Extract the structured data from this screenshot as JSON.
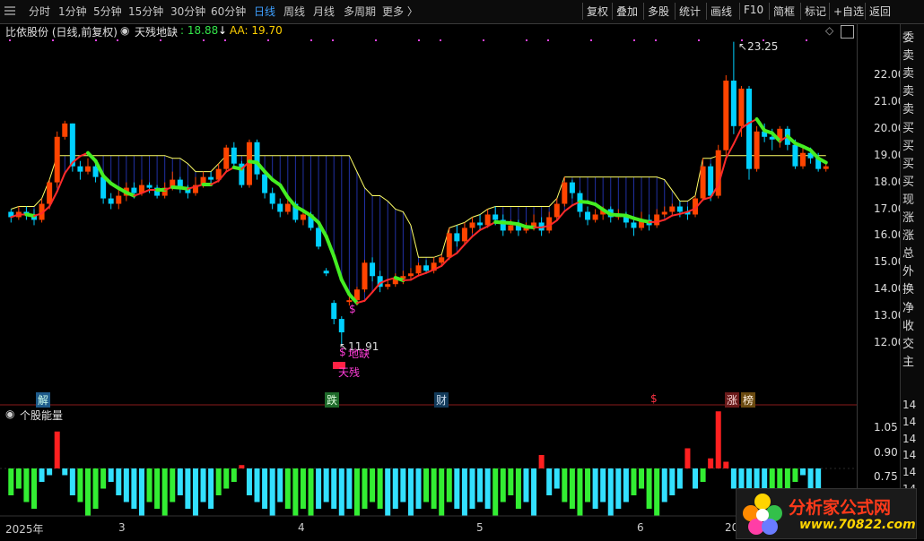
{
  "toolbar": {
    "timeframes": [
      "分时",
      "1分钟",
      "5分钟",
      "15分钟",
      "30分钟",
      "60分钟",
      "日线",
      "周线",
      "月线",
      "多周期",
      "更多 〉"
    ],
    "active_timeframe": "日线",
    "buttons": [
      "复权",
      "叠加",
      "多股",
      "统计",
      "画线",
      "F10",
      "简框",
      "标记",
      "+自选",
      "返回"
    ]
  },
  "chart": {
    "stock_title": "比依股份 (日线,前复权)",
    "indicator_name": "天残地缺",
    "indicator_value": ": 18.88",
    "indicator_arrow": "↓",
    "aa_label": "AA: 19.70",
    "high_label": "23.25",
    "low_label": "11.91",
    "price_ticks": [
      "22.00",
      "21.00",
      "20.00",
      "19.00",
      "18.00",
      "17.00",
      "16.00",
      "15.00",
      "14.00",
      "13.00",
      "12.00"
    ],
    "annotations": {
      "dollar1": "$",
      "dollar2": "$",
      "di_que": "地缺",
      "tian_can": "天残"
    },
    "signals": [
      "解",
      "跌",
      "财",
      "$",
      "涨",
      "榜"
    ]
  },
  "volume_panel": {
    "title": "个股能量",
    "ticks": [
      "1.05",
      "0.90",
      "0.75"
    ],
    "right_ticks": [
      "14",
      "14",
      "14",
      "14",
      "14",
      "14",
      "14",
      "14"
    ]
  },
  "x_axis": {
    "labels": [
      "2025年",
      "3",
      "4",
      "5",
      "6",
      "20"
    ]
  },
  "right_panel": {
    "labels": [
      "委",
      "卖",
      "卖",
      "卖",
      "卖",
      "买",
      "买",
      "买",
      "买",
      "现",
      "涨",
      "涨",
      "总",
      "外",
      "换",
      "净",
      "收",
      "交",
      "主"
    ]
  },
  "watermark": {
    "text": "分析家公式网",
    "url": "www.70822.com"
  },
  "colors": {
    "up": "#ff4400",
    "down": "#00d0ff",
    "ma_up": "#ff2a2a",
    "ma_down": "#44ee22",
    "accent": "#3ea0ff"
  },
  "chart_data": {
    "type": "candlestick",
    "note_scale": "price",
    "ylim": [
      11.5,
      23.5
    ],
    "candles": [
      [
        16.9,
        16.7,
        17.0,
        16.5
      ],
      [
        16.7,
        16.9,
        17.1,
        16.6
      ],
      [
        16.9,
        16.8,
        17.1,
        16.6
      ],
      [
        16.8,
        16.6,
        17.0,
        16.4
      ],
      [
        16.6,
        17.2,
        17.4,
        16.5
      ],
      [
        17.2,
        18.0,
        18.1,
        17.0
      ],
      [
        18.0,
        19.7,
        19.9,
        17.8
      ],
      [
        19.7,
        20.2,
        20.3,
        19.6
      ],
      [
        20.2,
        18.6,
        20.2,
        18.4
      ],
      [
        18.6,
        18.4,
        18.8,
        18.1
      ],
      [
        18.4,
        18.6,
        18.9,
        18.3
      ],
      [
        18.6,
        18.2,
        18.7,
        18.0
      ],
      [
        18.2,
        17.4,
        18.3,
        17.2
      ],
      [
        17.4,
        17.2,
        17.6,
        17.0
      ],
      [
        17.2,
        17.5,
        17.8,
        17.0
      ],
      [
        17.5,
        17.8,
        18.0,
        17.3
      ],
      [
        17.8,
        17.6,
        18.0,
        17.4
      ],
      [
        17.6,
        17.9,
        18.1,
        17.5
      ],
      [
        17.9,
        17.8,
        18.0,
        17.6
      ],
      [
        17.8,
        17.5,
        17.9,
        17.4
      ],
      [
        17.5,
        17.8,
        18.0,
        17.4
      ],
      [
        17.8,
        18.1,
        18.4,
        17.7
      ],
      [
        18.1,
        17.8,
        18.2,
        17.6
      ],
      [
        17.8,
        17.6,
        17.9,
        17.4
      ],
      [
        17.6,
        17.9,
        18.2,
        17.5
      ],
      [
        17.9,
        18.2,
        18.4,
        17.8
      ],
      [
        18.2,
        18.1,
        18.4,
        17.9
      ],
      [
        18.1,
        18.5,
        18.7,
        18.0
      ],
      [
        18.5,
        19.3,
        19.4,
        18.4
      ],
      [
        19.3,
        18.7,
        19.5,
        18.5
      ],
      [
        18.7,
        17.9,
        18.8,
        17.8
      ],
      [
        17.9,
        19.5,
        19.6,
        17.8
      ],
      [
        19.5,
        18.3,
        19.6,
        18.1
      ],
      [
        18.3,
        17.6,
        18.4,
        17.4
      ],
      [
        17.6,
        17.2,
        17.8,
        17.0
      ],
      [
        17.2,
        16.9,
        17.4,
        16.7
      ],
      [
        16.9,
        17.2,
        17.5,
        16.8
      ],
      [
        17.2,
        16.6,
        17.3,
        16.5
      ],
      [
        16.6,
        16.8,
        17.0,
        16.4
      ],
      [
        16.8,
        16.3,
        16.9,
        16.2
      ],
      [
        16.3,
        15.6,
        16.4,
        15.5
      ],
      [
        14.7,
        14.6,
        14.8,
        14.5
      ],
      [
        13.5,
        12.9,
        13.6,
        12.7
      ],
      [
        12.9,
        12.4,
        13.0,
        11.9
      ],
      [
        13.6,
        13.6,
        13.8,
        13.4
      ],
      [
        13.6,
        14.0,
        14.1,
        13.4
      ],
      [
        14.0,
        15.0,
        15.1,
        13.9
      ],
      [
        15.0,
        14.5,
        15.2,
        14.3
      ],
      [
        14.5,
        14.1,
        14.7,
        13.9
      ],
      [
        14.1,
        14.2,
        14.4,
        14.0
      ],
      [
        14.2,
        14.4,
        14.6,
        14.1
      ],
      [
        14.4,
        14.5,
        14.7,
        14.2
      ],
      [
        14.5,
        14.6,
        14.8,
        14.4
      ],
      [
        14.6,
        14.9,
        15.0,
        14.5
      ],
      [
        14.9,
        14.7,
        15.1,
        14.6
      ],
      [
        14.7,
        15.0,
        15.2,
        14.6
      ],
      [
        15.0,
        15.2,
        15.3,
        14.9
      ],
      [
        15.2,
        16.1,
        16.3,
        15.1
      ],
      [
        16.1,
        15.8,
        16.4,
        15.6
      ],
      [
        15.8,
        16.3,
        16.5,
        15.7
      ],
      [
        16.3,
        16.5,
        16.7,
        16.1
      ],
      [
        16.5,
        16.4,
        16.8,
        16.2
      ],
      [
        16.4,
        16.8,
        17.0,
        16.3
      ],
      [
        16.8,
        16.6,
        17.1,
        16.4
      ],
      [
        16.6,
        16.2,
        16.8,
        16.0
      ],
      [
        16.2,
        16.4,
        16.6,
        16.1
      ],
      [
        16.4,
        16.2,
        16.6,
        16.0
      ],
      [
        16.2,
        16.3,
        16.5,
        16.1
      ],
      [
        16.3,
        16.5,
        16.8,
        16.2
      ],
      [
        16.5,
        16.2,
        16.7,
        16.0
      ],
      [
        16.2,
        16.7,
        16.9,
        16.1
      ],
      [
        16.7,
        17.2,
        17.4,
        16.6
      ],
      [
        17.2,
        18.0,
        18.2,
        17.1
      ],
      [
        18.0,
        17.6,
        18.1,
        17.4
      ],
      [
        17.6,
        16.9,
        17.7,
        16.7
      ],
      [
        16.9,
        16.6,
        17.1,
        16.4
      ],
      [
        16.6,
        16.8,
        17.0,
        16.5
      ],
      [
        16.8,
        17.0,
        17.1,
        16.6
      ],
      [
        17.0,
        16.7,
        17.1,
        16.5
      ],
      [
        16.7,
        16.8,
        17.0,
        16.6
      ],
      [
        16.8,
        16.5,
        16.9,
        16.3
      ],
      [
        16.5,
        16.3,
        16.7,
        16.0
      ],
      [
        16.3,
        16.6,
        16.9,
        16.2
      ],
      [
        16.6,
        16.4,
        16.8,
        16.2
      ],
      [
        16.4,
        16.8,
        17.0,
        16.3
      ],
      [
        16.8,
        16.9,
        17.1,
        16.7
      ],
      [
        16.9,
        17.1,
        17.2,
        16.8
      ],
      [
        17.1,
        16.9,
        17.3,
        16.7
      ],
      [
        16.9,
        16.8,
        17.1,
        16.6
      ],
      [
        16.8,
        17.4,
        17.5,
        16.7
      ],
      [
        17.4,
        18.6,
        18.9,
        17.3
      ],
      [
        18.6,
        17.5,
        18.7,
        17.3
      ],
      [
        17.5,
        19.2,
        19.4,
        17.4
      ],
      [
        19.2,
        21.8,
        22.0,
        19.0
      ],
      [
        21.8,
        20.1,
        23.25,
        19.8
      ],
      [
        20.1,
        21.5,
        21.6,
        19.7
      ],
      [
        21.5,
        18.5,
        21.6,
        18.1
      ],
      [
        18.5,
        19.9,
        20.1,
        18.4
      ],
      [
        19.9,
        19.7,
        20.2,
        19.5
      ],
      [
        19.7,
        19.6,
        20.0,
        19.2
      ],
      [
        19.6,
        20.0,
        20.1,
        19.3
      ],
      [
        20.0,
        19.4,
        20.1,
        19.2
      ],
      [
        19.4,
        18.6,
        19.6,
        18.5
      ],
      [
        18.6,
        19.1,
        19.3,
        18.5
      ],
      [
        19.1,
        18.9,
        19.3,
        18.7
      ],
      [
        18.9,
        18.5,
        19.1,
        18.4
      ],
      [
        18.5,
        18.6,
        18.8,
        18.4
      ]
    ],
    "energy": [
      -0.4,
      -0.3,
      -0.5,
      -0.6,
      -0.2,
      -0.1,
      0.55,
      -0.1,
      -0.4,
      -0.5,
      -0.7,
      -0.6,
      -0.3,
      -0.2,
      -0.4,
      -0.5,
      -0.6,
      -0.7,
      -0.5,
      -0.6,
      -0.7,
      -0.5,
      -0.4,
      -0.6,
      -0.7,
      -0.5,
      -0.6,
      -0.4,
      -0.3,
      -0.2,
      0.05,
      -0.4,
      -0.5,
      -0.6,
      -0.7,
      -0.5,
      -0.6,
      -0.7,
      -0.6,
      -0.7,
      -0.6,
      -0.5,
      -0.6,
      -0.7,
      -0.6,
      -0.7,
      -0.6,
      -0.5,
      -0.6,
      -0.7,
      -0.6,
      -0.5,
      -0.7,
      -0.6,
      -0.5,
      -0.6,
      -0.7,
      -0.5,
      -0.6,
      -0.7,
      -0.6,
      -0.5,
      -0.6,
      -0.7,
      -0.5,
      -0.4,
      -0.6,
      -0.5,
      -0.7,
      0.2,
      -0.4,
      -0.3,
      -0.5,
      -0.6,
      -0.7,
      -0.5,
      -0.6,
      -0.5,
      -0.7,
      -0.6,
      -0.5,
      -0.4,
      -0.3,
      -0.6,
      -0.7,
      -0.5,
      -0.4,
      -0.3,
      0.3,
      -0.3,
      -0.2,
      0.15,
      0.85,
      0.1,
      -0.3,
      -0.4,
      -0.3,
      -0.5,
      -0.4,
      -0.3,
      -0.4,
      -0.3,
      -0.2,
      -0.1,
      -0.3,
      -0.4
    ]
  }
}
